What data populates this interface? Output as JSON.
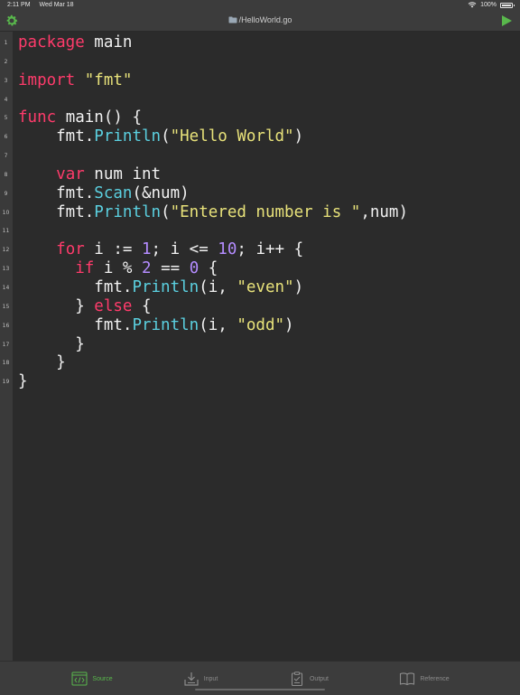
{
  "status": {
    "time": "2:11 PM",
    "date": "Wed Mar 18",
    "battery": "100%",
    "battery_level": 1.0
  },
  "header": {
    "title": "/HelloWorld.go"
  },
  "colors": {
    "text": "#f1f1f1",
    "keyword": "#ff3b6b",
    "function": "#5bd0e0",
    "string": "#e8e27a",
    "number": "#b48cff",
    "accent": "#59b84c"
  },
  "icons": {
    "settings": "gear-icon",
    "run": "play-icon",
    "file": "folder-icon"
  },
  "code_lines": [
    {
      "n": "1",
      "tokens": [
        {
          "t": "package",
          "c": "keyword"
        },
        {
          "t": " main",
          "c": "text"
        }
      ]
    },
    {
      "n": "2",
      "tokens": []
    },
    {
      "n": "3",
      "tokens": [
        {
          "t": "import",
          "c": "keyword"
        },
        {
          "t": " ",
          "c": "text"
        },
        {
          "t": "\"fmt\"",
          "c": "string"
        }
      ]
    },
    {
      "n": "4",
      "tokens": []
    },
    {
      "n": "5",
      "tokens": [
        {
          "t": "func",
          "c": "keyword"
        },
        {
          "t": " main() {",
          "c": "text"
        }
      ]
    },
    {
      "n": "6",
      "tokens": [
        {
          "t": "    fmt.",
          "c": "text"
        },
        {
          "t": "Println",
          "c": "function"
        },
        {
          "t": "(",
          "c": "text"
        },
        {
          "t": "\"Hello World\"",
          "c": "string"
        },
        {
          "t": ")",
          "c": "text"
        }
      ]
    },
    {
      "n": "7",
      "tokens": []
    },
    {
      "n": "8",
      "tokens": [
        {
          "t": "    ",
          "c": "text"
        },
        {
          "t": "var",
          "c": "keyword"
        },
        {
          "t": " num int",
          "c": "text"
        }
      ]
    },
    {
      "n": "9",
      "tokens": [
        {
          "t": "    fmt.",
          "c": "text"
        },
        {
          "t": "Scan",
          "c": "function"
        },
        {
          "t": "(&num)",
          "c": "text"
        }
      ]
    },
    {
      "n": "10",
      "tokens": [
        {
          "t": "    fmt.",
          "c": "text"
        },
        {
          "t": "Println",
          "c": "function"
        },
        {
          "t": "(",
          "c": "text"
        },
        {
          "t": "\"Entered number is \"",
          "c": "string"
        },
        {
          "t": ",num)",
          "c": "text"
        }
      ]
    },
    {
      "n": "11",
      "tokens": []
    },
    {
      "n": "12",
      "tokens": [
        {
          "t": "    ",
          "c": "text"
        },
        {
          "t": "for",
          "c": "keyword"
        },
        {
          "t": " i := ",
          "c": "text"
        },
        {
          "t": "1",
          "c": "number"
        },
        {
          "t": "; i <= ",
          "c": "text"
        },
        {
          "t": "10",
          "c": "number"
        },
        {
          "t": "; i++ {",
          "c": "text"
        }
      ]
    },
    {
      "n": "13",
      "tokens": [
        {
          "t": "      ",
          "c": "text"
        },
        {
          "t": "if",
          "c": "keyword"
        },
        {
          "t": " i % ",
          "c": "text"
        },
        {
          "t": "2",
          "c": "number"
        },
        {
          "t": " == ",
          "c": "text"
        },
        {
          "t": "0",
          "c": "number"
        },
        {
          "t": " {",
          "c": "text"
        }
      ]
    },
    {
      "n": "14",
      "tokens": [
        {
          "t": "        fmt.",
          "c": "text"
        },
        {
          "t": "Println",
          "c": "function"
        },
        {
          "t": "(i, ",
          "c": "text"
        },
        {
          "t": "\"even\"",
          "c": "string"
        },
        {
          "t": ")",
          "c": "text"
        }
      ]
    },
    {
      "n": "15",
      "tokens": [
        {
          "t": "      } ",
          "c": "text"
        },
        {
          "t": "else",
          "c": "keyword"
        },
        {
          "t": " {",
          "c": "text"
        }
      ]
    },
    {
      "n": "16",
      "tokens": [
        {
          "t": "        fmt.",
          "c": "text"
        },
        {
          "t": "Println",
          "c": "function"
        },
        {
          "t": "(i, ",
          "c": "text"
        },
        {
          "t": "\"odd\"",
          "c": "string"
        },
        {
          "t": ")",
          "c": "text"
        }
      ]
    },
    {
      "n": "17",
      "tokens": [
        {
          "t": "      }",
          "c": "text"
        }
      ]
    },
    {
      "n": "18",
      "tokens": [
        {
          "t": "    }",
          "c": "text"
        }
      ]
    },
    {
      "n": "19",
      "tokens": [
        {
          "t": "}",
          "c": "text"
        }
      ]
    }
  ],
  "tabs": [
    {
      "label": "Source",
      "icon": "code-icon",
      "active": true
    },
    {
      "label": "Input",
      "icon": "download-icon",
      "active": false
    },
    {
      "label": "Output",
      "icon": "clipboard-icon",
      "active": false
    },
    {
      "label": "Reference",
      "icon": "book-icon",
      "active": false
    }
  ]
}
